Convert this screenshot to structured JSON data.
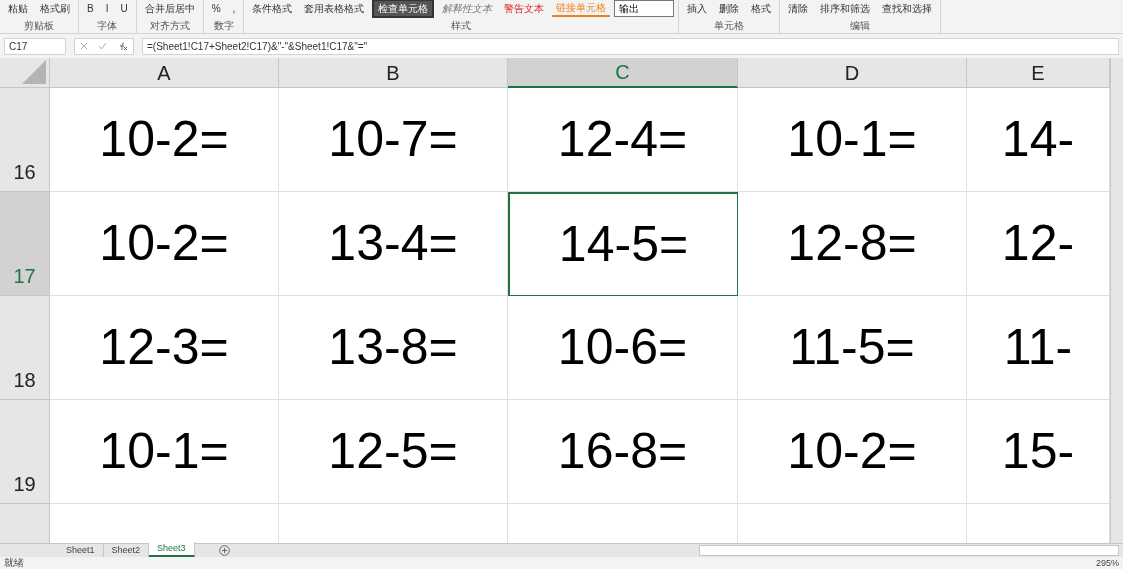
{
  "ribbon": {
    "groups": [
      {
        "label": "剪贴板",
        "items": [
          {
            "kind": "button",
            "text": "粘贴"
          },
          {
            "kind": "button",
            "text": "格式刷"
          }
        ]
      },
      {
        "label": "字体",
        "items": [
          {
            "kind": "button",
            "text": "B"
          },
          {
            "kind": "button",
            "text": "I"
          },
          {
            "kind": "button",
            "text": "U"
          }
        ]
      },
      {
        "label": "对齐方式",
        "items": [
          {
            "kind": "button",
            "text": "合并后居中"
          }
        ]
      },
      {
        "label": "数字",
        "items": [
          {
            "kind": "button",
            "text": "%"
          },
          {
            "kind": "button",
            "text": ","
          }
        ]
      },
      {
        "label": "样式",
        "items": [
          {
            "kind": "button",
            "text": "条件格式"
          },
          {
            "kind": "button",
            "text": "套用表格格式"
          },
          {
            "kind": "style-dark",
            "text": "检查单元格"
          },
          {
            "kind": "style-italic",
            "text": "解释性文本"
          },
          {
            "kind": "style-warning",
            "text": "警告文本"
          },
          {
            "kind": "style-link",
            "text": "链接单元格"
          },
          {
            "kind": "style-box",
            "text": "输出"
          }
        ]
      },
      {
        "label": "单元格",
        "items": [
          {
            "kind": "button",
            "text": "插入"
          },
          {
            "kind": "button",
            "text": "删除"
          },
          {
            "kind": "button",
            "text": "格式"
          }
        ]
      },
      {
        "label": "编辑",
        "items": [
          {
            "kind": "button",
            "text": "清除"
          },
          {
            "kind": "button",
            "text": "排序和筛选"
          },
          {
            "kind": "button",
            "text": "查找和选择"
          }
        ]
      }
    ]
  },
  "formula_bar": {
    "name_box": "C17",
    "formula": "=(Sheet1!C17+Sheet2!C17)&\"-\"&Sheet1!C17&\"=\""
  },
  "columns": [
    {
      "label": "A",
      "selected": false
    },
    {
      "label": "B",
      "selected": false
    },
    {
      "label": "C",
      "selected": true
    },
    {
      "label": "D",
      "selected": false
    },
    {
      "label": "E",
      "selected": false
    }
  ],
  "rows": [
    {
      "label": "16",
      "selected": false,
      "cells": [
        "10-2=",
        "10-7=",
        "12-4=",
        "10-1=",
        "14-"
      ]
    },
    {
      "label": "17",
      "selected": true,
      "cells": [
        "10-2=",
        "13-4=",
        "14-5=",
        "12-8=",
        "12-"
      ]
    },
    {
      "label": "18",
      "selected": false,
      "cells": [
        "12-3=",
        "13-8=",
        "10-6=",
        "11-5=",
        "11-"
      ]
    },
    {
      "label": "19",
      "selected": false,
      "cells": [
        "10-1=",
        "12-5=",
        "16-8=",
        "10-2=",
        "15-"
      ]
    }
  ],
  "sheet_tabs": [
    {
      "label": "Sheet1",
      "selected": false
    },
    {
      "label": "Sheet2",
      "selected": false
    },
    {
      "label": "Sheet3",
      "selected": true
    }
  ],
  "status_bar": {
    "status": "就绪",
    "zoom": "295%"
  }
}
